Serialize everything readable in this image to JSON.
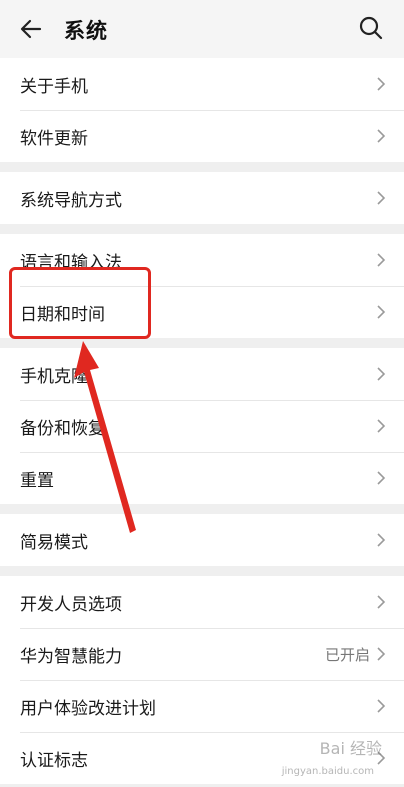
{
  "header": {
    "title": "系统",
    "back_icon": "arrow-left-icon",
    "search_icon": "search-icon"
  },
  "groups": [
    {
      "items": [
        {
          "label": "关于手机"
        },
        {
          "label": "软件更新"
        }
      ]
    },
    {
      "items": [
        {
          "label": "系统导航方式"
        }
      ]
    },
    {
      "items": [
        {
          "label": "语言和输入法"
        },
        {
          "label": "日期和时间"
        }
      ]
    },
    {
      "items": [
        {
          "label": "手机克隆"
        },
        {
          "label": "备份和恢复"
        },
        {
          "label": "重置"
        }
      ]
    },
    {
      "items": [
        {
          "label": "简易模式"
        }
      ]
    },
    {
      "items": [
        {
          "label": "开发人员选项"
        },
        {
          "label": "华为智慧能力",
          "value": "已开启"
        },
        {
          "label": "用户体验改进计划"
        },
        {
          "label": "认证标志"
        }
      ]
    }
  ],
  "annotation": {
    "highlight_color": "#e02820",
    "highlighted_item": "日期和时间"
  },
  "watermark": {
    "brand": "Bai 经验",
    "url": "jingyan.baidu.com"
  }
}
